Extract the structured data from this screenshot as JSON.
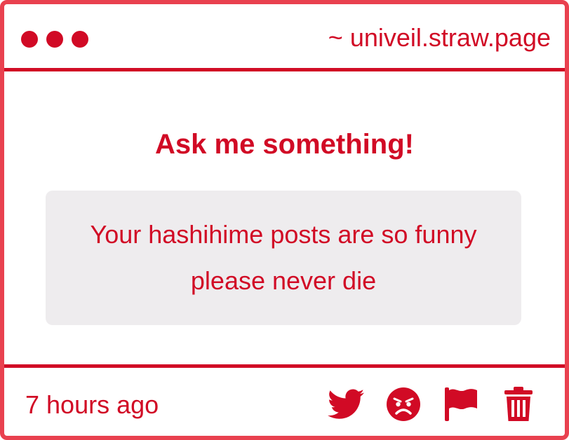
{
  "header": {
    "site_url": "~ univeil.straw.page"
  },
  "main": {
    "prompt": "Ask me something!",
    "question": "Your hashihime posts are so funny please never die"
  },
  "footer": {
    "timestamp": "7 hours ago",
    "actions": [
      {
        "icon": "twitter-bird-icon"
      },
      {
        "icon": "angry-face-icon"
      },
      {
        "icon": "flag-icon"
      },
      {
        "icon": "trash-icon"
      }
    ]
  },
  "colors": {
    "accent": "#d10a25",
    "border": "#e9414f",
    "question_bg": "#eeecee",
    "background": "#ffffff"
  }
}
